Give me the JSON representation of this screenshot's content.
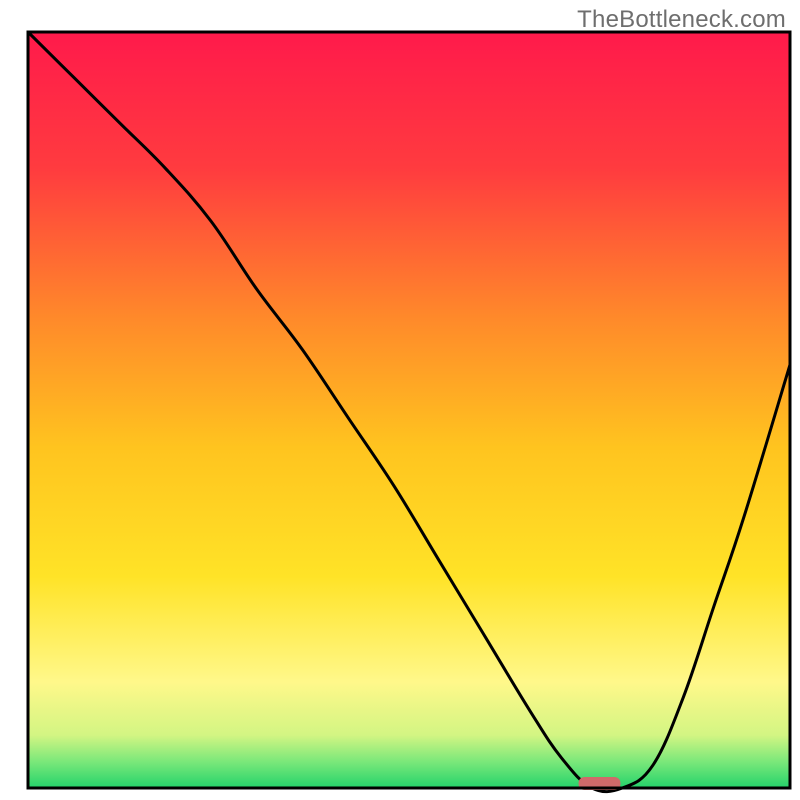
{
  "watermark": "TheBottleneck.com",
  "chart_data": {
    "type": "line",
    "title": "",
    "xlabel": "",
    "ylabel": "",
    "xlim": [
      0,
      100
    ],
    "ylim": [
      0,
      100
    ],
    "axes_visible": false,
    "grid": false,
    "background_gradient_stops": [
      {
        "offset": 0.0,
        "color": "#ff1a4b"
      },
      {
        "offset": 0.18,
        "color": "#ff3b3f"
      },
      {
        "offset": 0.38,
        "color": "#ff8a2a"
      },
      {
        "offset": 0.55,
        "color": "#ffc41f"
      },
      {
        "offset": 0.72,
        "color": "#ffe327"
      },
      {
        "offset": 0.86,
        "color": "#fff88a"
      },
      {
        "offset": 0.93,
        "color": "#d3f583"
      },
      {
        "offset": 0.965,
        "color": "#7be87a"
      },
      {
        "offset": 1.0,
        "color": "#24d36b"
      }
    ],
    "series": [
      {
        "name": "bottleneck-curve",
        "x": [
          0,
          6,
          12,
          18,
          24,
          30,
          36,
          42,
          48,
          54,
          60,
          66,
          70,
          74,
          78,
          82,
          86,
          90,
          94,
          100
        ],
        "values": [
          100,
          94,
          88,
          82,
          75,
          66,
          58,
          49,
          40,
          30,
          20,
          10,
          4,
          0,
          0,
          3,
          12,
          24,
          36,
          56
        ]
      }
    ],
    "marker": {
      "name": "optimal-point",
      "x": 75,
      "y": 0,
      "width_frac": 0.055,
      "color": "#d06a6a"
    },
    "frame": {
      "stroke": "#000000",
      "stroke_width": 3
    }
  }
}
